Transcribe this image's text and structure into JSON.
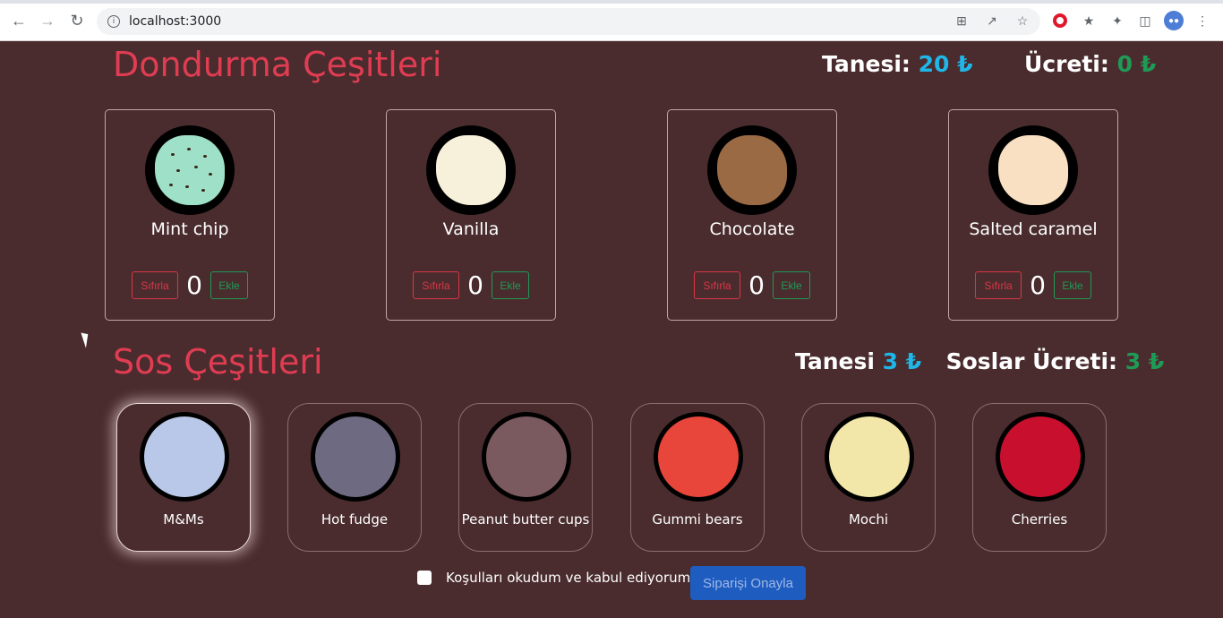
{
  "browser": {
    "url": "localhost:3000"
  },
  "icecream": {
    "title": "Dondurma Çeşitleri",
    "unit_label": "Tanesi:",
    "unit_price": "20 ₺",
    "total_label": "Ücreti:",
    "total_price": "0 ₺",
    "items": [
      {
        "name": "Mint chip",
        "count": "0",
        "reset_label": "Sıfırla",
        "add_label": "Ekle",
        "color": "#9ee0c8"
      },
      {
        "name": "Vanilla",
        "count": "0",
        "reset_label": "Sıfırla",
        "add_label": "Ekle",
        "color": "#f7f1dc"
      },
      {
        "name": "Chocolate",
        "count": "0",
        "reset_label": "Sıfırla",
        "add_label": "Ekle",
        "color": "#9a6a45"
      },
      {
        "name": "Salted caramel",
        "count": "0",
        "reset_label": "Sıfırla",
        "add_label": "Ekle",
        "color": "#fae0c2"
      }
    ]
  },
  "sauces": {
    "title": "Sos Çeşitleri",
    "unit_label": "Tanesi",
    "unit_price": "3 ₺",
    "total_label": "Soslar Ücreti:",
    "total_price": "3 ₺",
    "items": [
      {
        "name": "M&Ms",
        "selected": true,
        "color": "#b9c8e8"
      },
      {
        "name": "Hot fudge",
        "selected": false,
        "color": "#6e6a82"
      },
      {
        "name": "Peanut butter cups",
        "selected": false,
        "color": "#7a5a5e"
      },
      {
        "name": "Gummi bears",
        "selected": false,
        "color": "#e8463a"
      },
      {
        "name": "Mochi",
        "selected": false,
        "color": "#f2e6a8"
      },
      {
        "name": "Cherries",
        "selected": false,
        "color": "#c8102e"
      }
    ]
  },
  "footer": {
    "terms_label": "Koşulları okudum ve kabul ediyorum",
    "confirm_label": "Siparişi Onayla"
  }
}
